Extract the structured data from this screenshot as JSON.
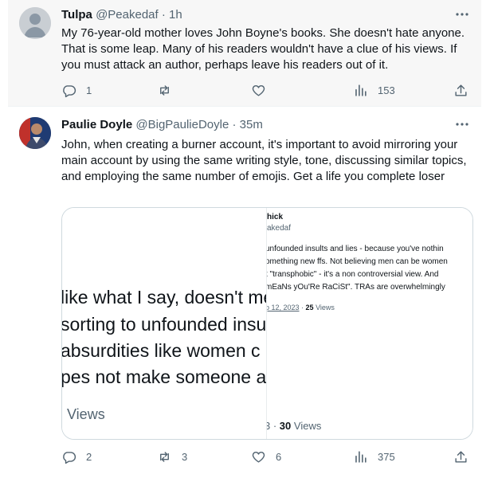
{
  "tweets": [
    {
      "name": "Tulpa",
      "handle": "@Peakedaf",
      "time": "1h",
      "text": "My 76-year-old mother loves John Boyne's books. She doesn't hate anyone. That is some leap. Many of his readers wouldn't have a clue of his views. If you must attack an author, perhaps leave his readers out of it.",
      "replies": "1",
      "retweets": "",
      "likes": "",
      "views": "153"
    },
    {
      "name": "Paulie Doyle",
      "handle": "@BigPaulieDoyle",
      "time": "35m",
      "text": "John, when creating a burner account, it's important to avoid mirroring your main account by using the same writing style, tone, discussing similar topics, and employing the same number of emojis. Get a life you complete loser",
      "replies": "2",
      "retweets": "3",
      "likes": "6",
      "views": "375"
    }
  ],
  "separator": " · ",
  "media": {
    "left_lines": [
      "like what I say, doesn't me",
      "sorting to unfounded insu",
      "absurdities like women c",
      "pes not make someone a"
    ],
    "left_views": "Views",
    "right_name": "hick",
    "right_handle": "akedaf",
    "right_lines": [
      "unfounded insults and lies - because you've nothin",
      "omething new ffs. Not believing men can be women",
      "t \"transphobic\" - it's a non controversial view. And",
      "mEaNs yOu'Re RaCiSt\". TRAs are overwhelmingly"
    ],
    "right_date": "p 12, 2023",
    "right_views_count": "25",
    "right_views_label": "Views",
    "bottom_prefix": "3 · ",
    "bottom_views_count": "30",
    "bottom_views_label": "Views"
  },
  "colors": {
    "text": "#0f1419",
    "secondary": "#536471",
    "border": "#cfd9de",
    "bg_highlight": "#f7f7f7"
  },
  "icons": [
    "more-icon",
    "reply-icon",
    "retweet-icon",
    "like-icon",
    "views-icon",
    "share-icon"
  ]
}
